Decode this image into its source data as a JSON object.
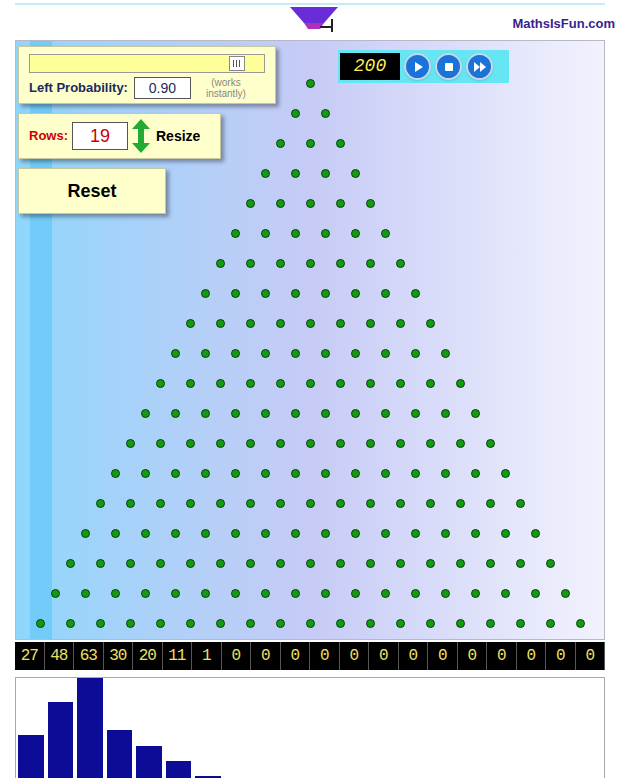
{
  "brand": "MathsIsFun.com",
  "probability": {
    "label": "Left Probability:",
    "value": "0.90",
    "note": "(works instantly)",
    "level": 0.9
  },
  "rows": {
    "label": "Rows:",
    "value": "19",
    "button": "Resize"
  },
  "reset": "Reset",
  "counter": "200",
  "peg_rows": 19,
  "bins": [
    "27",
    "48",
    "63",
    "30",
    "20",
    "11",
    "1",
    "0",
    "0",
    "0",
    "0",
    "0",
    "0",
    "0",
    "0",
    "0",
    "0",
    "0",
    "0",
    "0"
  ],
  "histogram": {
    "values": [
      27,
      48,
      63,
      30,
      20,
      11,
      1,
      0,
      0,
      0,
      0,
      0,
      0,
      0,
      0,
      0,
      0,
      0,
      0,
      0
    ]
  }
}
